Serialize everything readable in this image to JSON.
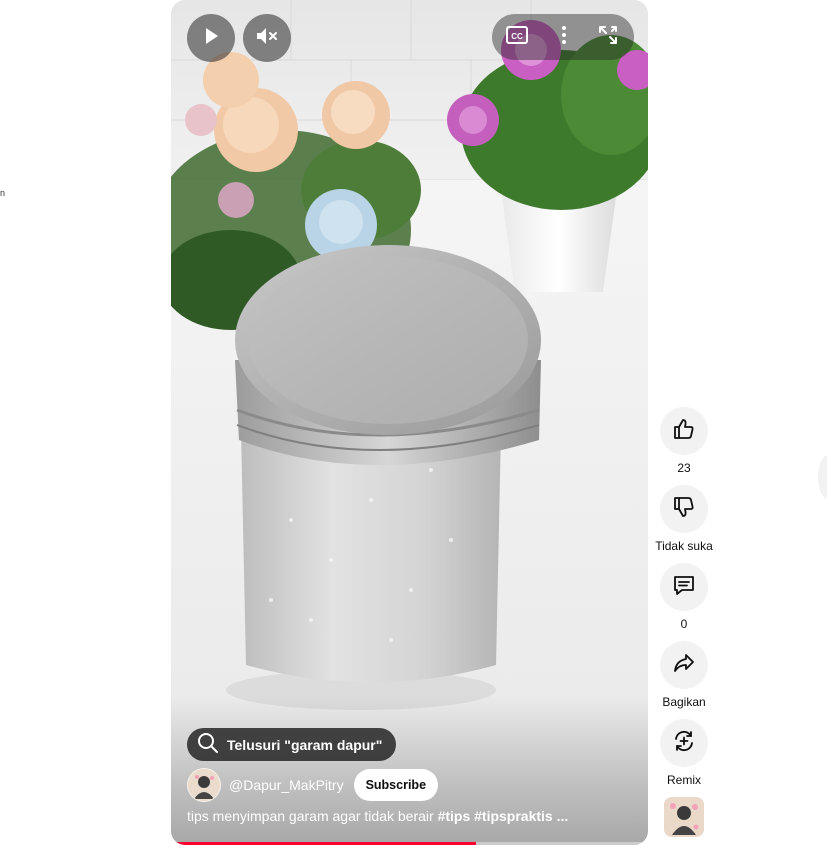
{
  "page": {
    "left_fragment_text": "n"
  },
  "player": {
    "controls": {
      "play_icon": "play-icon",
      "mute_icon": "volume-muted-icon",
      "captions_icon": "closed-captions-icon",
      "captions_label": "CC",
      "more_icon": "more-vertical-icon",
      "fullscreen_icon": "fullscreen-icon"
    },
    "search_chip": {
      "label": "Telusuri \"garam dapur\"",
      "icon": "search-icon"
    },
    "channel": {
      "handle": "@Dapur_MakPitry",
      "subscribe_label": "Subscribe"
    },
    "caption": {
      "text": "tips menyimpan garam agar tidak berair ",
      "hashtags": "#tips #tipspraktis",
      "ellipsis": " ..."
    },
    "progress": {
      "fraction": 0.64,
      "color": "#ff0033"
    }
  },
  "actions": {
    "like": {
      "icon": "thumbs-up-icon",
      "label": "23"
    },
    "dislike": {
      "icon": "thumbs-down-icon",
      "label": "Tidak suka"
    },
    "comments": {
      "icon": "comment-icon",
      "label": "0"
    },
    "share": {
      "icon": "share-icon",
      "label": "Bagikan"
    },
    "remix": {
      "icon": "remix-icon",
      "label": "Remix"
    }
  }
}
